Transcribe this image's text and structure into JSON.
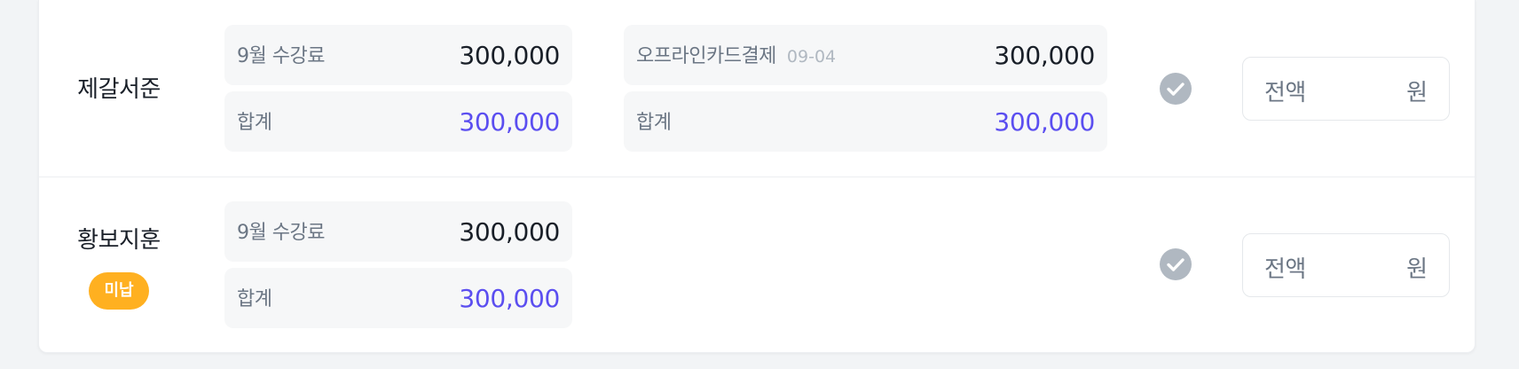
{
  "rows": [
    {
      "student": "제갈서준",
      "fee": {
        "label": "9월 수강료",
        "amount": "300,000",
        "total_label": "합계",
        "total": "300,000"
      },
      "payment": {
        "method": "오프라인카드결제",
        "date": "09-04",
        "amount": "300,000",
        "total_label": "합계",
        "total": "300,000"
      },
      "input": {
        "placeholder": "전액",
        "unit": "원"
      }
    },
    {
      "student": "황보지훈",
      "badge": "미납",
      "fee": {
        "label": "9월 수강료",
        "amount": "300,000",
        "total_label": "합계",
        "total": "300,000"
      },
      "input": {
        "placeholder": "전액",
        "unit": "원"
      }
    }
  ],
  "colors": {
    "total_amount": "#5b4ef0",
    "badge_unpaid": "#ffb020",
    "check_inactive": "#b0b8c1"
  },
  "icons": {
    "check": "check-circle-icon"
  }
}
